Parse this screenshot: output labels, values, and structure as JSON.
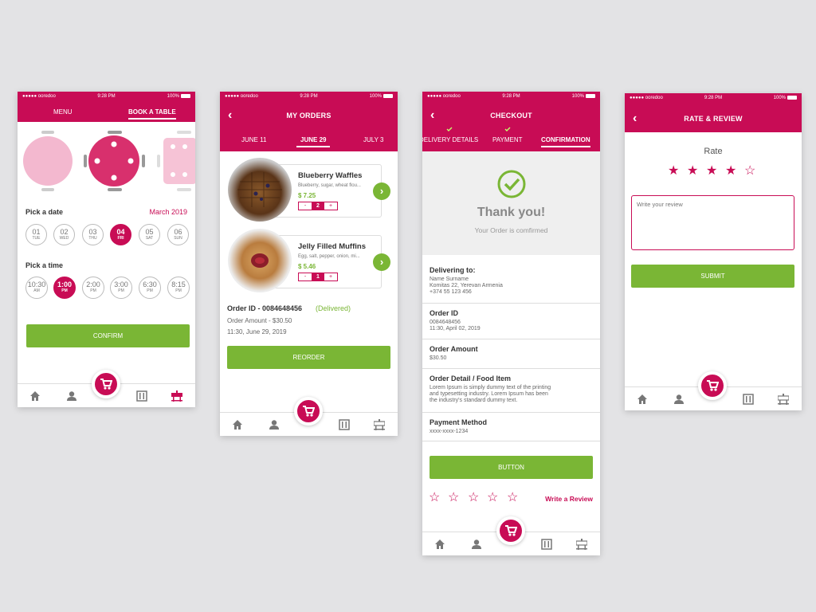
{
  "colors": {
    "brand": "#c80c55",
    "accent_green": "#7ab635",
    "background": "#e3e3e5"
  },
  "status_bar": {
    "carrier": "●●●●● ooredoo",
    "time": "9:28 PM",
    "battery": "100%"
  },
  "screen1": {
    "tabs": [
      "MENU",
      "BOOK A TABLE"
    ],
    "pick_date_label": "Pick a date",
    "month": "March 2019",
    "dates": [
      {
        "num": "01",
        "day": "TUE"
      },
      {
        "num": "02",
        "day": "WED"
      },
      {
        "num": "03",
        "day": "THU"
      },
      {
        "num": "04",
        "day": "FRI",
        "selected": true
      },
      {
        "num": "05",
        "day": "SAT"
      },
      {
        "num": "06",
        "day": "SUN"
      }
    ],
    "pick_time_label": "Pick a time",
    "times": [
      {
        "time": "10:30",
        "period": "AM"
      },
      {
        "time": "1:00",
        "period": "PM",
        "selected": true
      },
      {
        "time": "2:00",
        "period": "PM"
      },
      {
        "time": "3:00",
        "period": "PM"
      },
      {
        "time": "6:30",
        "period": "PM"
      },
      {
        "time": "8:15",
        "period": "PM"
      }
    ],
    "confirm_label": "CONFIRM"
  },
  "screen2": {
    "title": "MY ORDERS",
    "tabs": [
      "JUNE 11",
      "JUNE 29",
      "JULY 3"
    ],
    "items": [
      {
        "name": "Blueberry Waffles",
        "desc": "Blueberry, sugar, wheat flou...",
        "price": "$ 7.25",
        "qty": "2"
      },
      {
        "name": "Jelly Filled Muffins",
        "desc": "Egg, salt, pepper, onion, mi...",
        "price": "$ 5.46",
        "qty": "1"
      }
    ],
    "order_id": "Order ID - 0084648456",
    "order_status": "(Delivered)",
    "order_amount": "Order Amount - $30.50",
    "order_time": "11:30, June 29, 2019",
    "reorder_label": "REORDER"
  },
  "screen3": {
    "title": "CHECKOUT",
    "steps": [
      "DELIVERY DETAILS",
      "PAYMENT",
      "CONFIRMATION"
    ],
    "thank_you": "Thank you!",
    "confirmed": "Your Order is comfirmed",
    "rows": [
      {
        "title": "Delivering to:",
        "detail": "Name Surname\nKomitas 22, Yerevan Armenia\n+374 55 123 456"
      },
      {
        "title": "Order ID",
        "detail": "0084648456\n11:30, April 02, 2019"
      },
      {
        "title": "Order Amount",
        "detail": "$30.50"
      },
      {
        "title": "Order Detail / Food Item",
        "detail": "Lorem Ipsum is simply dummy text of the printing\nand typesetting industry. Lorem Ipsum has been\nthe industry's standard dummy text."
      },
      {
        "title": "Payment Method",
        "detail": "xxxx-xxxx-1234"
      }
    ],
    "button_label": "BUTTON",
    "write_review": "Write a Review"
  },
  "screen4": {
    "title": "RATE & REVIEW",
    "rate_label": "Rate",
    "rating": 4,
    "rating_max": 5,
    "review_placeholder": "Write your review",
    "submit_label": "SUBMIT"
  }
}
